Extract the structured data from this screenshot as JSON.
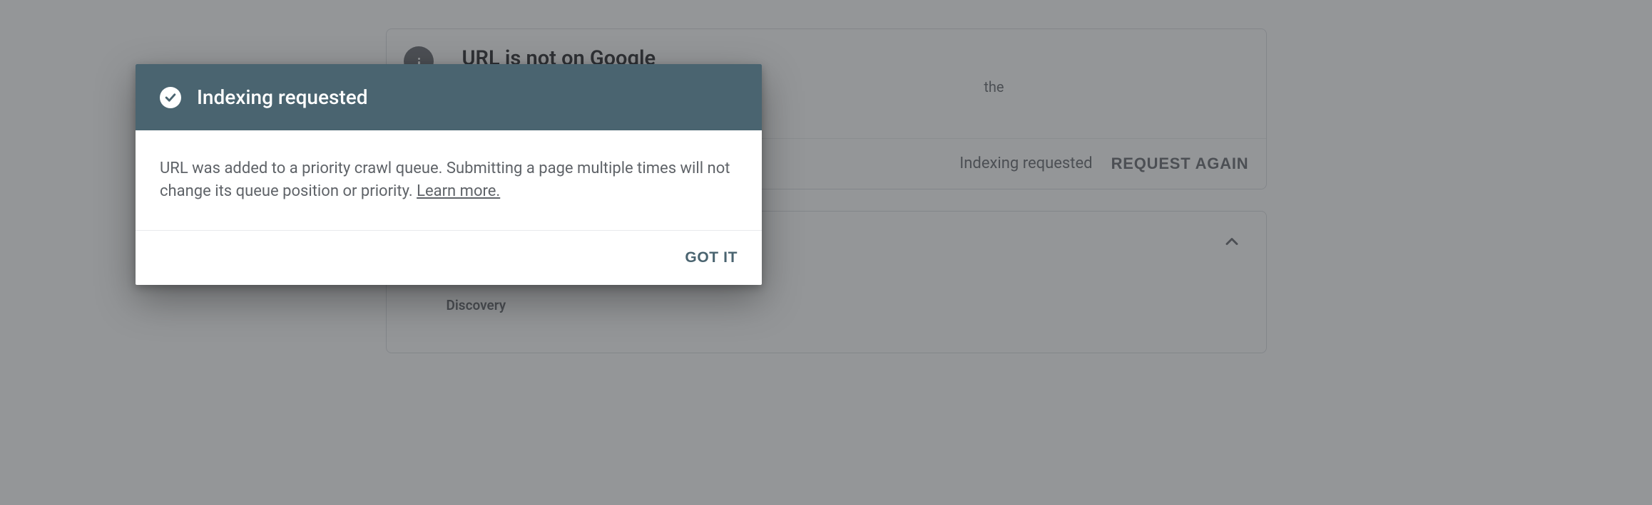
{
  "background": {
    "card1": {
      "title": "URL is not on Google",
      "subtitle_suffix": "the",
      "status_text": "Indexing requested",
      "request_again_label": "REQUEST AGAIN"
    },
    "card2": {
      "discovery_label": "Discovery"
    }
  },
  "dialog": {
    "title": "Indexing requested",
    "body_text": "URL was added to a priority crawl queue. Submitting a page multiple times will not change its queue position or priority. ",
    "learn_more_label": "Learn more.",
    "confirm_label": "GOT IT"
  }
}
